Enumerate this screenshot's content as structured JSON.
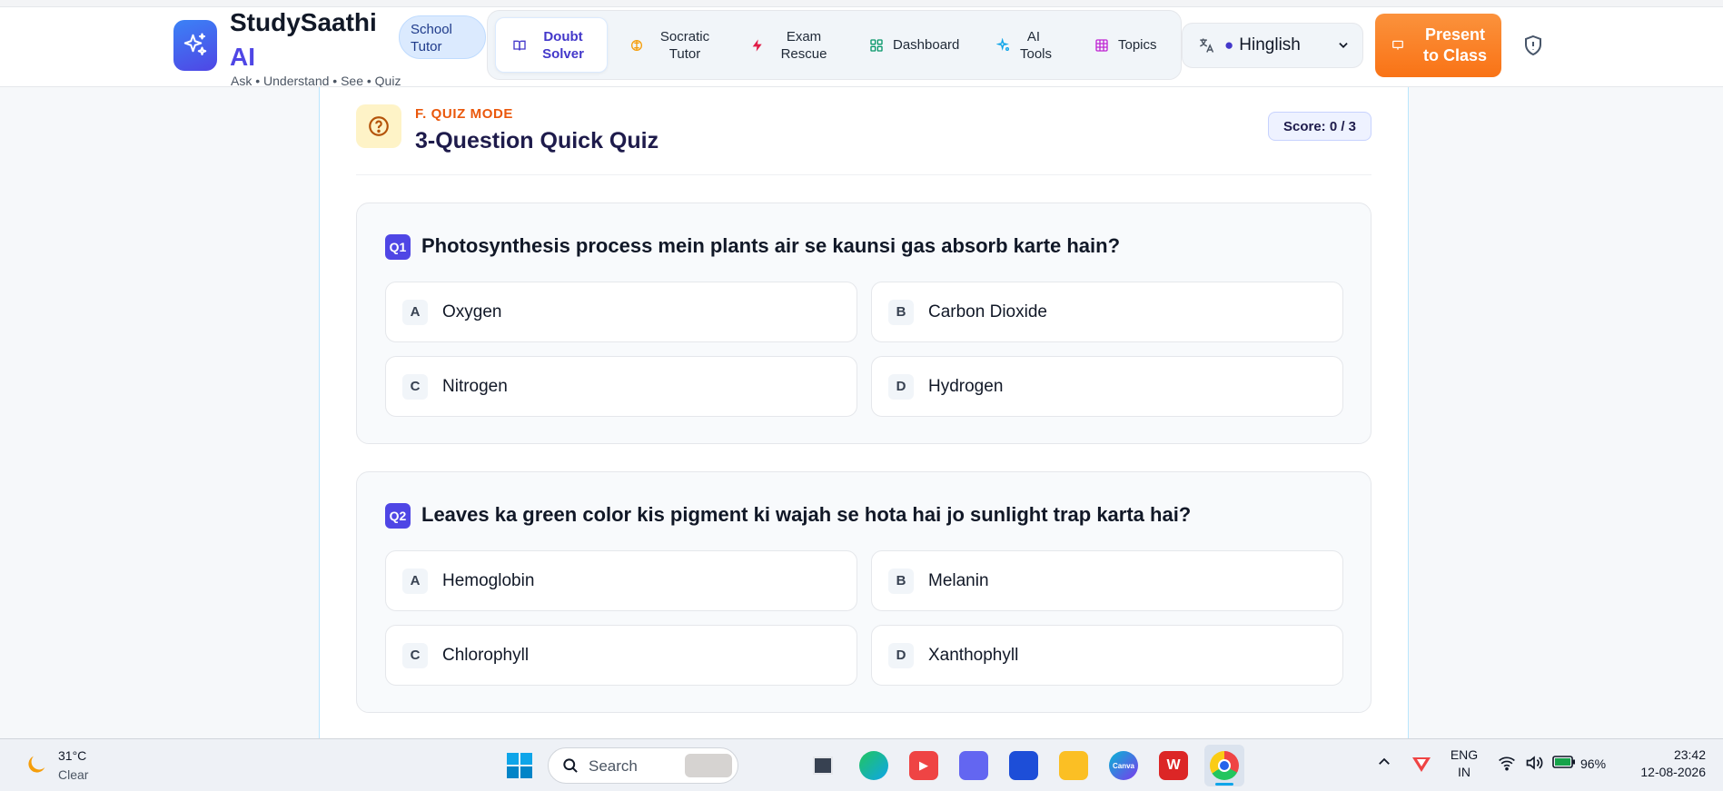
{
  "app": {
    "brand_name": "StudySaathi",
    "brand_suffix": "AI",
    "tagline": "Ask • Understand • See • Quiz",
    "mode_pill": "School Tutor"
  },
  "nav": {
    "items": [
      {
        "label": "Doubt Solver",
        "icon": "book-open-icon",
        "active": true
      },
      {
        "label": "Socratic Tutor",
        "icon": "brain-icon",
        "active": false
      },
      {
        "label": "Exam Rescue",
        "icon": "lightning-icon",
        "active": false
      },
      {
        "label": "Dashboard",
        "icon": "grid-icon",
        "active": false
      },
      {
        "label": "AI Tools",
        "icon": "sparkles-icon",
        "active": false
      },
      {
        "label": "Topics",
        "icon": "table-icon",
        "active": false
      }
    ]
  },
  "language": {
    "selected": "Hinglish"
  },
  "present_button": {
    "label": "Present to Class"
  },
  "quiz": {
    "mode_label": "F. QUIZ MODE",
    "title": "3-Question Quick Quiz",
    "score": "Score: 0 / 3",
    "questions": [
      {
        "badge": "Q1",
        "text": "Photosynthesis process mein plants air se kaunsi gas absorb karte hain?",
        "options": [
          {
            "key": "A",
            "text": "Oxygen"
          },
          {
            "key": "B",
            "text": "Carbon Dioxide"
          },
          {
            "key": "C",
            "text": "Nitrogen"
          },
          {
            "key": "D",
            "text": "Hydrogen"
          }
        ]
      },
      {
        "badge": "Q2",
        "text": "Leaves ka green color kis pigment ki wajah se hota hai jo sunlight trap karta hai?",
        "options": [
          {
            "key": "A",
            "text": "Hemoglobin"
          },
          {
            "key": "B",
            "text": "Melanin"
          },
          {
            "key": "C",
            "text": "Chlorophyll"
          },
          {
            "key": "D",
            "text": "Xanthophyll"
          }
        ]
      }
    ]
  },
  "taskbar": {
    "weather_temp": "31°C",
    "weather_condition": "Clear",
    "search_placeholder": "Search",
    "language_line1": "ENG",
    "language_line2": "IN",
    "battery": "96%",
    "time": "23:42",
    "date": "12-08-2026",
    "canva_label": "Canva"
  },
  "colors": {
    "accent": "#4f46e5",
    "present_orange": "#f97316",
    "mode_label_orange": "#ea580c"
  }
}
